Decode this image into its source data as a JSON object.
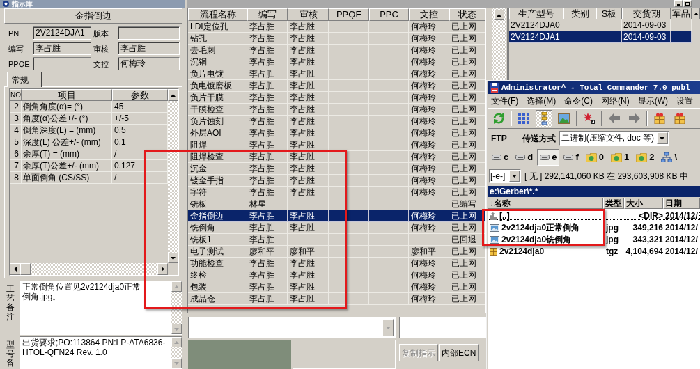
{
  "window": {
    "title": "指示库"
  },
  "instruction": {
    "title": "金指倒边",
    "fields": [
      {
        "label": "PN",
        "value": "2V2124DJA1"
      },
      {
        "label": "版本"
      },
      {
        "label": "编写",
        "value": "李占胜"
      },
      {
        "label": "审核",
        "value": "李占胜"
      },
      {
        "label": "PPQE"
      },
      {
        "label": "文控",
        "value": "何梅玲"
      }
    ]
  },
  "tabs": [
    {
      "label": "常规",
      "selected": true
    }
  ],
  "params_table": {
    "columns": [
      "NO",
      "项目",
      "参数"
    ],
    "rows": [
      {
        "no": "2",
        "item": "倒角角度(α)= (°)",
        "value": "45"
      },
      {
        "no": "3",
        "item": "角度(α)公差+/- (°)",
        "value": "+/-5"
      },
      {
        "no": "4",
        "item": "倒角深度(L) = (mm)",
        "value": "0.5"
      },
      {
        "no": "5",
        "item": "深度(L) 公差+/- (mm)",
        "value": "0.1"
      },
      {
        "no": "6",
        "item": "余厚(T) = (mm)",
        "value": "/"
      },
      {
        "no": "7",
        "item": "余厚(T)公差+/- (mm)",
        "value": "0.127"
      },
      {
        "no": "8",
        "item": "单面倒角 (CS/SS)",
        "value": "/"
      }
    ]
  },
  "process_note": {
    "label": "工艺备注",
    "text": "正常倒角位置见2v2124dja0正常倒角.jpg。"
  },
  "model_note": {
    "label": "型号备",
    "text": "出货要求;PO:113864 PN:LP-ATA6836-HTOL-QFN24 Rev. 1.0"
  },
  "process_table": {
    "columns": [
      "流程名称",
      "编写",
      "审核",
      "PPQE",
      "PPC",
      "文控",
      "状态"
    ],
    "rows": [
      {
        "name": "LDI定位孔",
        "author": "李占胜",
        "reviewer": "李占胜",
        "doc_control": "何梅玲",
        "status": "已上网",
        "selected": false
      },
      {
        "name": "钻孔",
        "author": "李占胜",
        "reviewer": "李占胜",
        "doc_control": "何梅玲",
        "status": "已上网",
        "selected": false
      },
      {
        "name": "去毛刺",
        "author": "李占胜",
        "reviewer": "李占胜",
        "doc_control": "何梅玲",
        "status": "已上网",
        "selected": false
      },
      {
        "name": "沉铜",
        "author": "李占胜",
        "reviewer": "李占胜",
        "doc_control": "何梅玲",
        "status": "已上网",
        "selected": false
      },
      {
        "name": "负片电镀",
        "author": "李占胜",
        "reviewer": "李占胜",
        "doc_control": "何梅玲",
        "status": "已上网",
        "selected": false
      },
      {
        "name": "负电镀磨板",
        "author": "李占胜",
        "reviewer": "李占胜",
        "doc_control": "何梅玲",
        "status": "已上网",
        "selected": false
      },
      {
        "name": "负片干膜",
        "author": "李占胜",
        "reviewer": "李占胜",
        "doc_control": "何梅玲",
        "status": "已上网",
        "selected": false
      },
      {
        "name": "干膜检查",
        "author": "李占胜",
        "reviewer": "李占胜",
        "doc_control": "何梅玲",
        "status": "已上网",
        "selected": false
      },
      {
        "name": "负片蚀刻",
        "author": "李占胜",
        "reviewer": "李占胜",
        "doc_control": "何梅玲",
        "status": "已上网",
        "selected": false
      },
      {
        "name": "外层AOI",
        "author": "李占胜",
        "reviewer": "李占胜",
        "doc_control": "何梅玲",
        "status": "已上网",
        "selected": false
      },
      {
        "name": "阻焊",
        "author": "李占胜",
        "reviewer": "李占胜",
        "doc_control": "何梅玲",
        "status": "已上网",
        "selected": false
      },
      {
        "name": "阻焊检查",
        "author": "李占胜",
        "reviewer": "李占胜",
        "doc_control": "何梅玲",
        "status": "已上网",
        "selected": false
      },
      {
        "name": "沉金",
        "author": "李占胜",
        "reviewer": "李占胜",
        "doc_control": "何梅玲",
        "status": "已上网",
        "selected": false
      },
      {
        "name": "镀金手指",
        "author": "李占胜",
        "reviewer": "李占胜",
        "doc_control": "何梅玲",
        "status": "已上网",
        "selected": false
      },
      {
        "name": "字符",
        "author": "李占胜",
        "reviewer": "李占胜",
        "doc_control": "何梅玲",
        "status": "已上网",
        "selected": false
      },
      {
        "name": "铣板",
        "author": "林星",
        "status": "已编写",
        "selected": false
      },
      {
        "name": "金指倒边",
        "author": "李占胜",
        "reviewer": "李占胜",
        "doc_control": "何梅玲",
        "status": "已上网",
        "selected": true
      },
      {
        "name": "铣倒角",
        "author": "李占胜",
        "reviewer": "李占胜",
        "doc_control": "何梅玲",
        "status": "已上网",
        "selected": false
      },
      {
        "name": "铣板1",
        "author": "李占胜",
        "status": "已回退",
        "selected": false
      },
      {
        "name": "电子测试",
        "author": "廖和平",
        "reviewer": "廖和平",
        "doc_control": "廖和平",
        "status": "已上网",
        "selected": false
      },
      {
        "name": "功能检查",
        "author": "李占胜",
        "reviewer": "李占胜",
        "doc_control": "何梅玲",
        "status": "已上网",
        "selected": false
      },
      {
        "name": "终检",
        "author": "李占胜",
        "reviewer": "李占胜",
        "doc_control": "何梅玲",
        "status": "已上网",
        "selected": false
      },
      {
        "name": "包装",
        "author": "李占胜",
        "reviewer": "李占胜",
        "doc_control": "何梅玲",
        "status": "已上网",
        "selected": false
      },
      {
        "name": "成品仓",
        "author": "李占胜",
        "reviewer": "李占胜",
        "doc_control": "何梅玲",
        "status": "已上网",
        "selected": false
      }
    ]
  },
  "buttons": [
    {
      "label": "复制指示",
      "disabled": true
    },
    {
      "label": "内部ECN",
      "disabled": false
    }
  ],
  "models_table": {
    "columns": [
      "生产型号",
      "类别",
      "S板",
      "交货期",
      "军品"
    ],
    "rows": [
      {
        "model": "2V2124DJA0",
        "delivery_date": "2014-09-03",
        "selected": false
      },
      {
        "model": "2V2124DJA1",
        "delivery_date": "2014-09-03",
        "selected": true
      }
    ]
  },
  "file_manager": {
    "title": "Administrator^ - Total Commander 7.0 publ",
    "menu": [
      "文件(F)",
      "选择(M)",
      "命令(C)",
      "网络(N)",
      "显示(W)",
      "设置"
    ],
    "toolbar": [
      {
        "selected": false
      },
      {
        "selected": false
      },
      {
        "selected": true
      },
      {
        "selected": false
      },
      {
        "selected": false
      },
      {
        "selected": false
      },
      {
        "selected": false
      },
      {
        "selected": false
      },
      {
        "selected": false
      }
    ],
    "ftp_label": "FTP",
    "transfer_label": "传送方式",
    "transfer_mode": "二进制(压缩文件, doc 等)",
    "drives": [
      {
        "label": "c",
        "kind": "disk",
        "selected": false
      },
      {
        "label": "d",
        "kind": "disk",
        "selected": false
      },
      {
        "label": "e",
        "kind": "disk",
        "selected": true
      },
      {
        "label": "f",
        "kind": "disk",
        "selected": false
      },
      {
        "label": "0",
        "kind": "folder",
        "selected": false
      },
      {
        "label": "1",
        "kind": "folder",
        "selected": false
      },
      {
        "label": "2",
        "kind": "folder",
        "selected": false
      },
      {
        "label": "\\",
        "kind": "network",
        "selected": false
      }
    ],
    "drive_combo": "[-e-]",
    "free_space": "[ 无 ] 292,141,060 KB 在 293,603,908 KB 中",
    "path": "e:\\Gerber\\*.*",
    "columns": [
      "↓名称",
      "类型",
      "大小",
      "日期"
    ],
    "files": [
      {
        "kind": "parent",
        "name": "[..]",
        "size": "<DIR>",
        "date": "2014/12/",
        "focused": true
      },
      {
        "kind": "image",
        "name": "2v2124dja0正常倒角",
        "type": "jpg",
        "size": "349,216",
        "date": "2014/12/",
        "focused": false
      },
      {
        "kind": "image",
        "name": "2v2124dja0铣倒角",
        "type": "jpg",
        "size": "343,321",
        "date": "2014/12/",
        "focused": false
      },
      {
        "kind": "archive",
        "name": "2v2124dja0",
        "type": "tgz",
        "size": "4,104,694",
        "date": "2014/12/",
        "focused": false
      }
    ]
  }
}
